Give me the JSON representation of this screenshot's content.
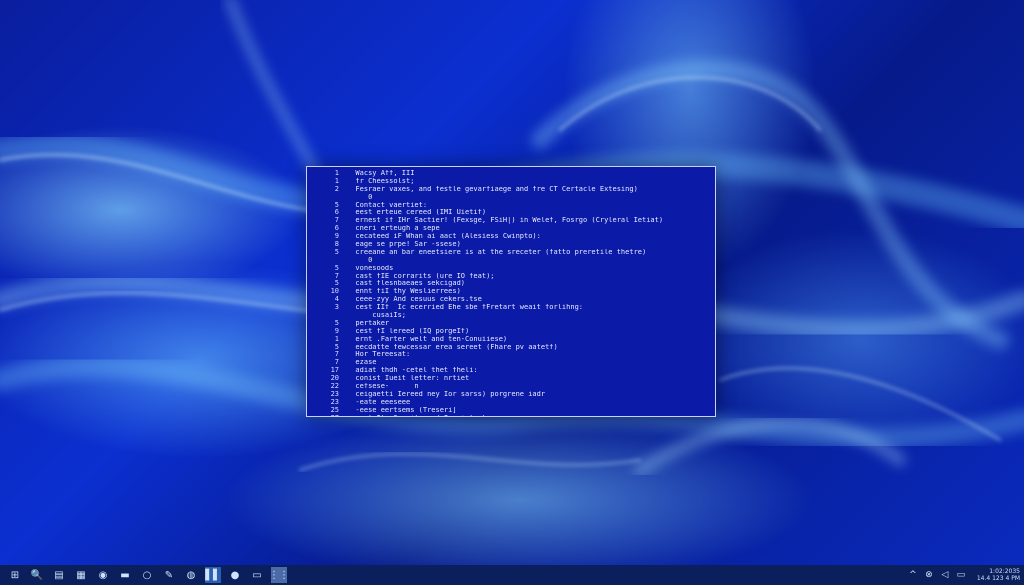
{
  "console": {
    "lines": [
      {
        "num": "1",
        "text": "  Wacsy Aff, III"
      },
      {
        "num": "1",
        "text": "  fr Cheessolst;"
      },
      {
        "num": "2",
        "text": "  Fesraer vaxes, and festle gevarfiaege and fre CT Certacle Extesing)"
      },
      {
        "num": "",
        "text": "     0"
      },
      {
        "num": "5",
        "text": "  Contact vaertiet:"
      },
      {
        "num": "6",
        "text": "  eest erteue cereed (IMI Uietif)"
      },
      {
        "num": "7",
        "text": "  ernest if IHr Sactier! (Fexsge, FSiH|) in Welef, Fosrgo (Cryleral Ietiat)"
      },
      {
        "num": "6",
        "text": "  cneri erteugh a sepe"
      },
      {
        "num": "9",
        "text": "  cecateed iF Whan ai aact (Alesiess Cwinpto):"
      },
      {
        "num": "8",
        "text": "  eage se prpe! Sar -ssese)"
      },
      {
        "num": "5",
        "text": "  creeane an bar eneetsiere is at the sreceter (fatto preretile thetre)"
      },
      {
        "num": "",
        "text": "     0"
      },
      {
        "num": "5",
        "text": "  vonesoods"
      },
      {
        "num": "7",
        "text": "  cast fIE corrarits (ure IO feat);"
      },
      {
        "num": "5",
        "text": "  cast flesnbaeaes sekcigad)"
      },
      {
        "num": "10",
        "text": "  ennt fiI thy Weslierrees)"
      },
      {
        "num": "4",
        "text": "  ceee-zyy And cesuus cekers.tse"
      },
      {
        "num": "3",
        "text": "  cest IIf  Ic ecerried Ehe sbe fFretart weait forlihng:"
      },
      {
        "num": "",
        "text": "      cusaiIs;"
      },
      {
        "num": "5",
        "text": "  pertaker"
      },
      {
        "num": "9",
        "text": "  cest fI lereed (IQ porgeIf)"
      },
      {
        "num": "1",
        "text": "  ernt .Farter welt and ten-Conuiiese)"
      },
      {
        "num": "5",
        "text": "  eecdatte fewcessar erea sereet (Fhare pv aatetf)"
      },
      {
        "num": "7",
        "text": "  Hor Tereesat:"
      },
      {
        "num": "7",
        "text": "  ezase"
      },
      {
        "num": "17",
        "text": "  adiat thdh -cetel thet fheli:"
      },
      {
        "num": "20",
        "text": "  conist Iueit letter: nrtiet"
      },
      {
        "num": "22",
        "text": "  cefsese-      n"
      },
      {
        "num": "23",
        "text": "  ceigaetti Iereed ney Ior sarss) porgrene iadr"
      },
      {
        "num": "23",
        "text": "  -eate eeeseee"
      },
      {
        "num": "25",
        "text": "  -eese eertsems (Treseri]"
      },
      {
        "num": "27",
        "text": "  caet Ile Serrily and Ieerielayt"
      },
      {
        "num": "27",
        "text": "  enet erteestee, -makagee rexy mlI tetef)"
      },
      {
        "num": "39",
        "text": "  -- that tectiee is ergt (tugr AI SIG"
      }
    ]
  },
  "taskbar": {
    "left_icons": [
      {
        "name": "start-icon",
        "glyph": "⊞"
      },
      {
        "name": "search-icon",
        "glyph": "🔍"
      },
      {
        "name": "task-view-icon",
        "glyph": "▤"
      },
      {
        "name": "app-tiles-icon",
        "glyph": "▦"
      },
      {
        "name": "edge-icon",
        "glyph": "◉"
      },
      {
        "name": "folder-icon",
        "glyph": "▬"
      },
      {
        "name": "circle-icon",
        "glyph": "○"
      },
      {
        "name": "pen-icon",
        "glyph": "✎"
      },
      {
        "name": "globe-icon",
        "glyph": "◍"
      },
      {
        "name": "terminal-icon",
        "glyph": "▌▌"
      },
      {
        "name": "firefox-icon",
        "glyph": "●"
      },
      {
        "name": "notes-icon",
        "glyph": "▭"
      },
      {
        "name": "grid-icon",
        "glyph": "⋮⋮"
      }
    ],
    "tray_icons": [
      {
        "name": "chevron-up-icon",
        "glyph": "^"
      },
      {
        "name": "network-icon",
        "glyph": "⊗"
      },
      {
        "name": "speaker-icon",
        "glyph": "◁"
      },
      {
        "name": "battery-icon",
        "glyph": "▭"
      }
    ],
    "clock_line1": "1:02:2035",
    "clock_line2": "14.4 123 4 PM",
    "accent": "#2a5fb0",
    "bg": "#0a1f5c"
  }
}
